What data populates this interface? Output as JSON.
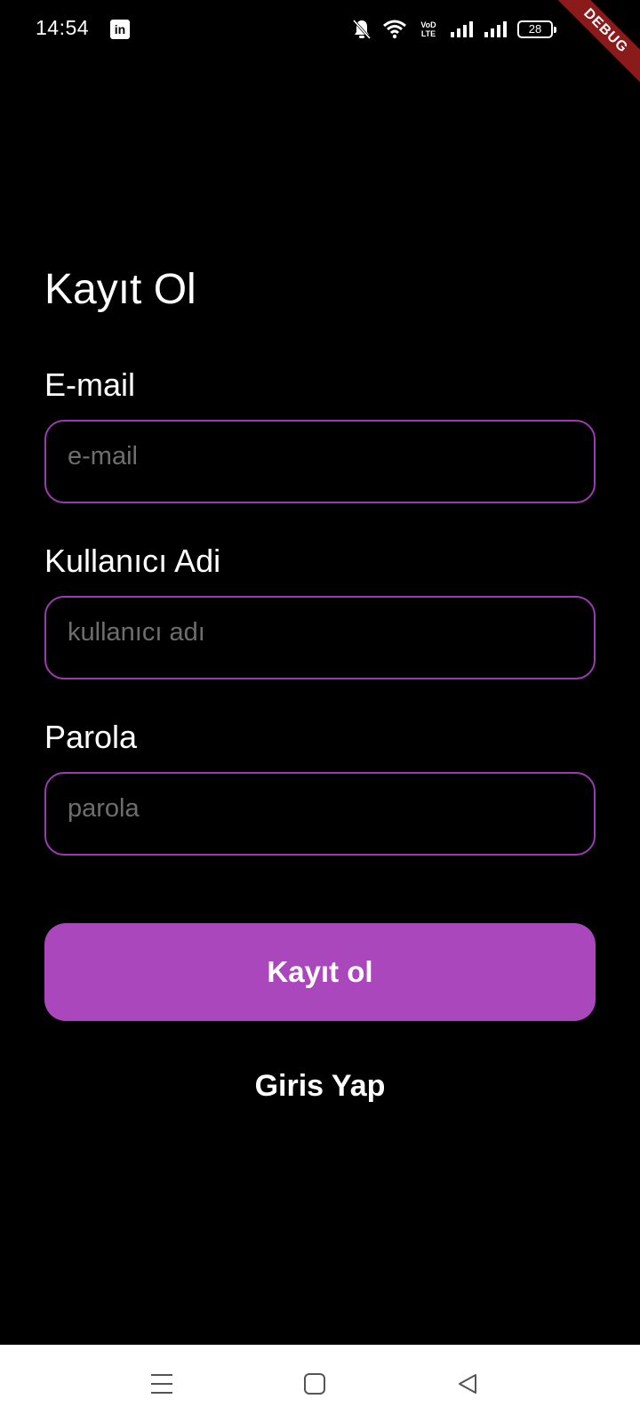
{
  "status_bar": {
    "time": "14:54",
    "app_icon": "linkedin-icon",
    "app_icon_glyph": "in",
    "network_label_top": "VoD",
    "network_label_bottom": "LTE",
    "battery": "28"
  },
  "debug_banner": "DEBUG",
  "form": {
    "title": "Kayıt Ol",
    "email": {
      "label": "E-mail",
      "placeholder": "e-mail",
      "value": ""
    },
    "username": {
      "label": "Kullanıcı Adi",
      "placeholder": "kullanıcı adı",
      "value": ""
    },
    "password": {
      "label": "Parola",
      "placeholder": "parola",
      "value": ""
    },
    "submit_label": "Kayıt ol",
    "login_link": "Giris Yap"
  },
  "nav_bar": {
    "menu_icon": "menu-icon",
    "home_icon": "home-square-icon",
    "back_icon": "back-triangle-icon"
  },
  "colors": {
    "background": "#000000",
    "accent": "#ab47bc",
    "input_border": "#9b3bb0",
    "placeholder": "#6e6e6e",
    "debug_ribbon": "#8b1a1a"
  }
}
